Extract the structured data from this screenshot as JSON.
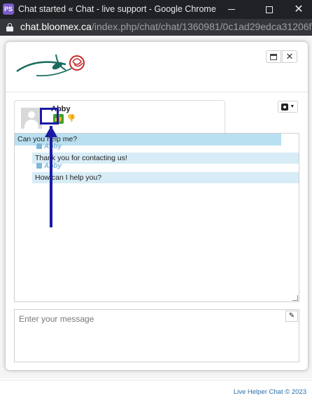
{
  "window": {
    "title": "Chat started « Chat - live support - Google Chrome",
    "app_icon_text": "PS"
  },
  "address_bar": {
    "host": "chat.bloomex.ca",
    "path": "/index.php/chat/chat/1360981/0c1ad29edca31206f315..."
  },
  "header": {
    "logo": "rose-logo"
  },
  "operator": {
    "name": "Abby"
  },
  "messages": [
    {
      "sender": "visitor",
      "text": "Can you help me?"
    },
    {
      "sender": "operator",
      "author": "Abby",
      "text": "Thank you for contacting us!"
    },
    {
      "sender": "operator",
      "author": "Abby",
      "text": "How can I help you?"
    }
  ],
  "input": {
    "placeholder": "Enter your message"
  },
  "footer": {
    "text": "Live Helper Chat © 2023"
  },
  "colors": {
    "visitor_bubble": "#b9e0f1",
    "operator_bubble": "#d7ecf6",
    "thumb_up": "#3aa132",
    "annotation": "#1a1aa6"
  }
}
